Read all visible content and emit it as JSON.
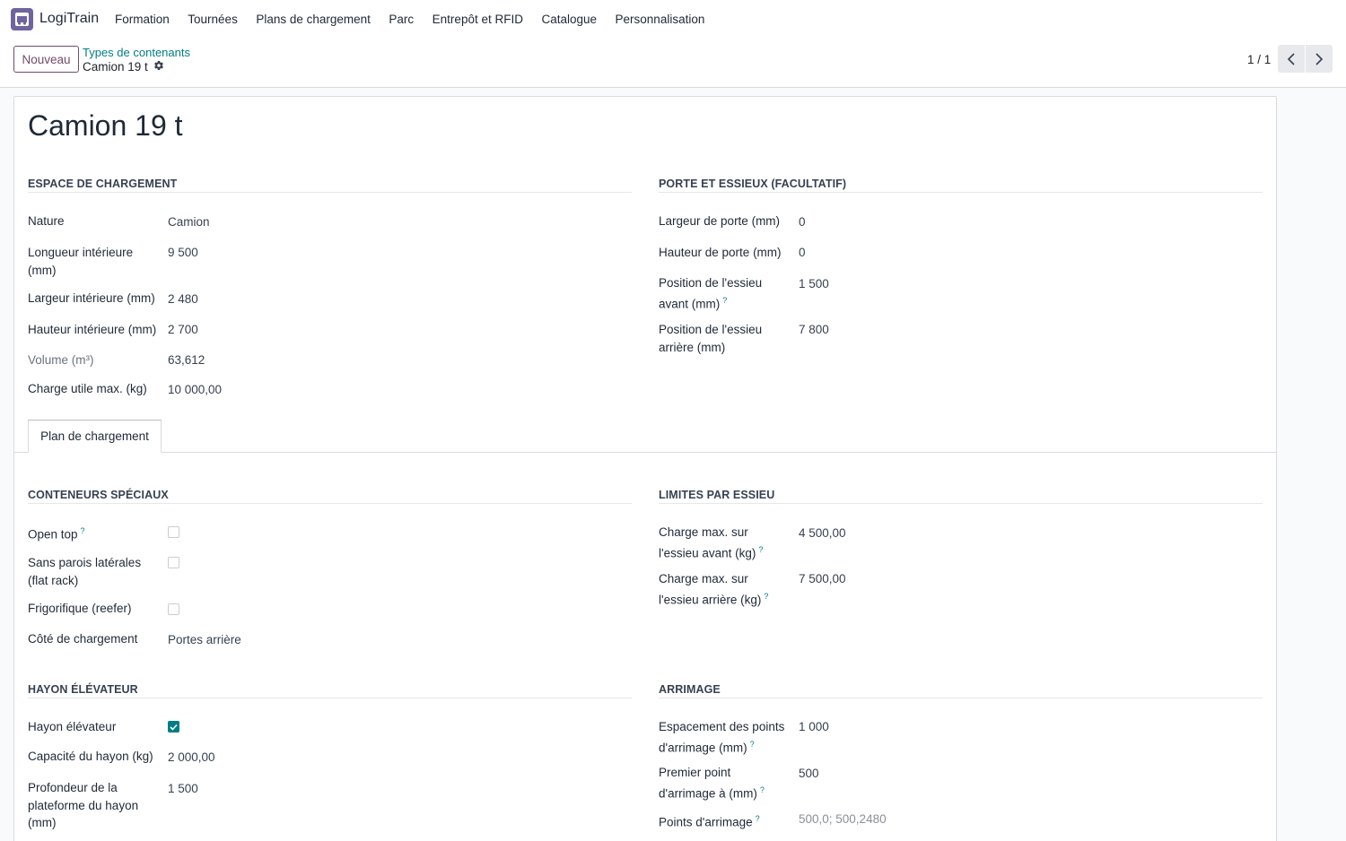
{
  "navbar": {
    "app_name": "LogiTrain",
    "menu": [
      "Formation",
      "Tournées",
      "Plans de chargement",
      "Parc",
      "Entrepôt et RFID",
      "Catalogue",
      "Personnalisation"
    ]
  },
  "control": {
    "new_button": "Nouveau",
    "breadcrumb_parent": "Types de contenants",
    "breadcrumb_current": "Camion 19 t",
    "pager": "1 / 1"
  },
  "record": {
    "title": "Camion 19 t"
  },
  "espace": {
    "title": "ESPACE DE CHARGEMENT",
    "nature_label": "Nature",
    "nature_value": "Camion",
    "longueur_label": "Longueur intérieure (mm)",
    "longueur_value": "9 500",
    "largeur_label": "Largeur intérieure (mm)",
    "largeur_value": "2 480",
    "hauteur_label": "Hauteur intérieure (mm)",
    "hauteur_value": "2 700",
    "volume_label": "Volume (m³)",
    "volume_value": "63,612",
    "charge_label": "Charge utile max. (kg)",
    "charge_value": "10 000,00"
  },
  "porte": {
    "title": "PORTE ET ESSIEUX (FACULTATIF)",
    "largeur_label": "Largeur de porte (mm)",
    "largeur_value": "0",
    "hauteur_label": "Hauteur de porte (mm)",
    "hauteur_value": "0",
    "avant_label": "Position de l'essieu avant (mm)",
    "avant_value": "1 500",
    "arriere_label": "Position de l'essieu arrière (mm)",
    "arriere_value": "7 800"
  },
  "tabs": {
    "active": "Plan de chargement"
  },
  "speciaux": {
    "title": "CONTENEURS SPÉCIAUX",
    "open_top_label": "Open top",
    "flat_rack_label": "Sans parois latérales (flat rack)",
    "reefer_label": "Frigorifique (reefer)",
    "cote_label": "Côté de chargement",
    "cote_value": "Portes arrière"
  },
  "limites": {
    "title": "LIMITES PAR ESSIEU",
    "avant_label": "Charge max. sur l'essieu avant (kg)",
    "avant_value": "4 500,00",
    "arriere_label": "Charge max. sur l'essieu arrière (kg)",
    "arriere_value": "7 500,00"
  },
  "hayon": {
    "title": "HAYON ÉLÉVATEUR",
    "hayon_label": "Hayon élévateur",
    "capacite_label": "Capacité du hayon (kg)",
    "capacite_value": "2 000,00",
    "profondeur_label": "Profondeur de la plateforme du hayon (mm)",
    "profondeur_value": "1 500"
  },
  "arrimage": {
    "title": "ARRIMAGE",
    "espacement_label": "Espacement des points d'arrimage (mm)",
    "espacement_value": "1 000",
    "premier_label": "Premier point d'arrimage à (mm)",
    "premier_value": "500",
    "points_label": "Points d'arrimage",
    "points_value": "500,0; 500,2480"
  },
  "help_mark": "?",
  "colors": {
    "accent": "#017e84",
    "primary": "#714b67",
    "app_icon": "#71639e"
  }
}
